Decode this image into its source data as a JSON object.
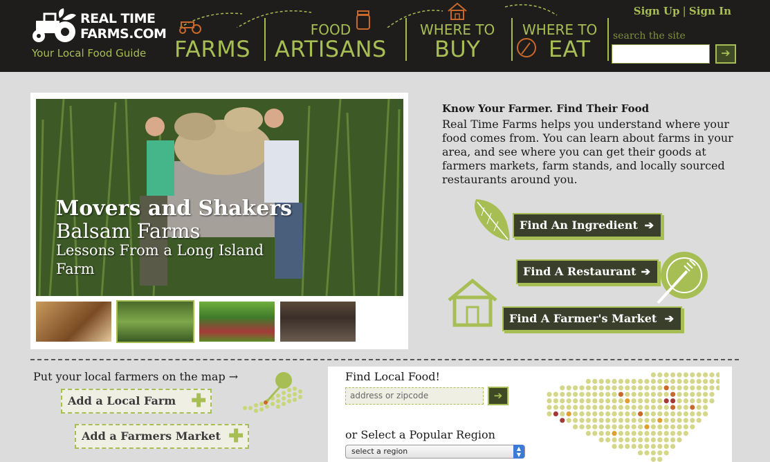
{
  "header": {
    "logo_line1": "REAL TIME",
    "logo_line2": "FARMS.COM",
    "tagline": "Your Local Food Guide",
    "nav": [
      {
        "small": "",
        "big": "FARMS"
      },
      {
        "small": "FOOD",
        "big": "ARTISANS"
      },
      {
        "small": "WHERE TO",
        "big": "BUY"
      },
      {
        "small": "WHERE TO",
        "big": "EAT"
      }
    ],
    "sign_up": "Sign Up",
    "sign_in": "Sign In",
    "search_label": "search the site",
    "search_value": "",
    "search_go": "➔"
  },
  "feature": {
    "title": "Movers and Shakers",
    "subtitle": "Balsam Farms",
    "caption": "Lessons From a Long Island Farm"
  },
  "intro": {
    "title": "Know Your Farmer. Find Their Food",
    "body": "Real Time Farms helps you understand where your food comes from. You can learn about farms in your area, and see where you can get their goods at farmers markets, farm stands, and locally sourced restaurants around you."
  },
  "find_buttons": {
    "ingredient": "Find An Ingredient",
    "restaurant": "Find A Restaurant",
    "market": "Find A Farmer's Market",
    "arrow": "➔"
  },
  "contribute": {
    "prompt": "Put your local farmers on the map →",
    "add_farm": "Add a Local Farm",
    "add_market": "Add a Farmers Market",
    "plus": "✚"
  },
  "find_local": {
    "title": "Find Local Food!",
    "placeholder": "address or zipcode",
    "go": "➔",
    "region_title": "or Select a Popular Region",
    "region_selected": "select a region"
  },
  "colors": {
    "accent": "#a7be55",
    "header_bg": "#1f1d1b",
    "button_dark": "#3a3f2b"
  }
}
